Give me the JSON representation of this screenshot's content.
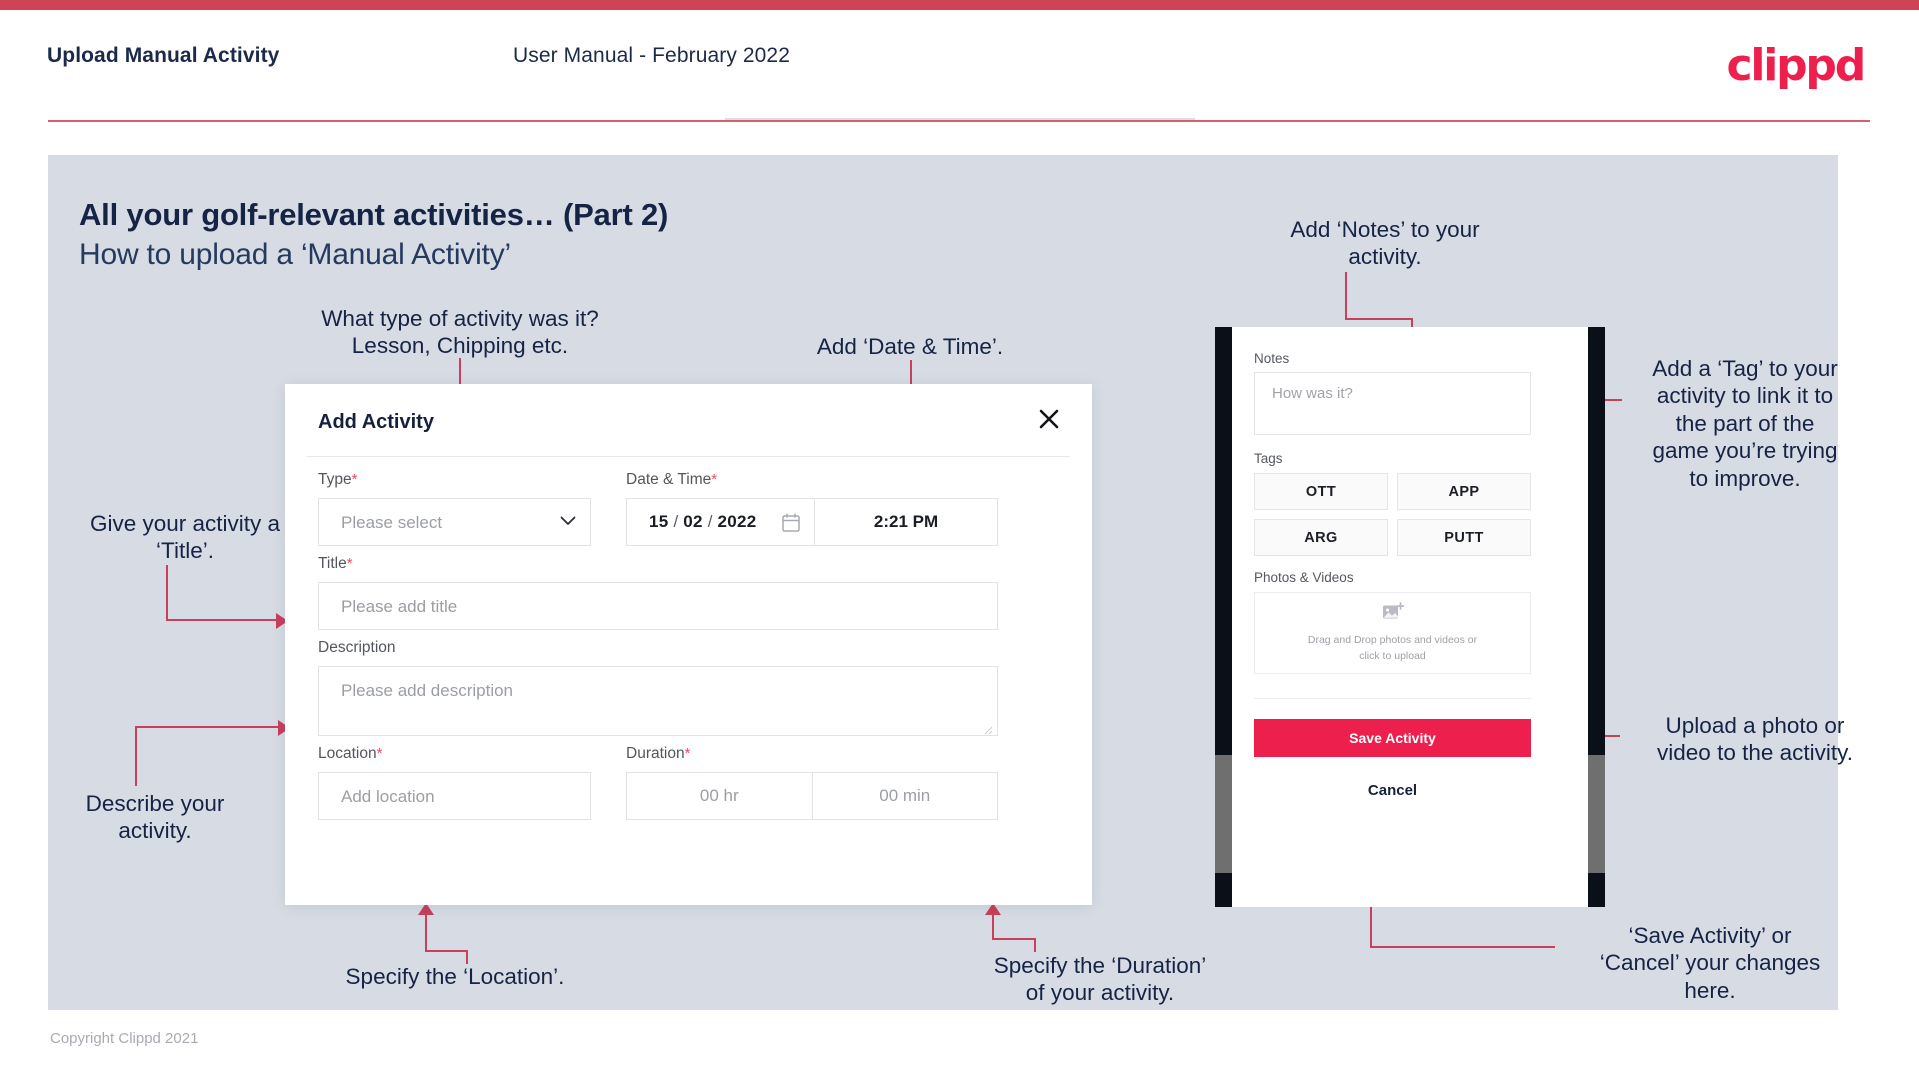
{
  "header": {
    "title": "Upload Manual Activity",
    "subtitle": "User Manual - February 2022",
    "logo": "clippd"
  },
  "slide": {
    "title": "All your golf-relevant activities… (Part 2)",
    "subtitle": "How to upload a ‘Manual Activity’"
  },
  "annotations": {
    "type": "What type of activity was it?\nLesson, Chipping etc.",
    "type_l1": "What type of activity was it?",
    "type_l2": "Lesson, Chipping etc.",
    "datetime": "Add ‘Date & Time’.",
    "title_l1": "Give your activity a",
    "title_l2": "‘Title’.",
    "description_l1": "Describe your",
    "description_l2": "activity.",
    "location": "Specify the ‘Location’.",
    "duration_l1": "Specify the ‘Duration’",
    "duration_l2": "of your activity.",
    "notes_l1": "Add ‘Notes’ to your",
    "notes_l2": "activity.",
    "tags_l1": "Add a ‘Tag’ to your",
    "tags_l2": "activity to link it to",
    "tags_l3": "the part of the",
    "tags_l4": "game you’re trying",
    "tags_l5": "to improve.",
    "upload_l1": "Upload a photo or",
    "upload_l2": "video to the activity.",
    "save_l1": "‘Save Activity’ or",
    "save_l2": "‘Cancel’ your changes",
    "save_l3": "here."
  },
  "modal": {
    "title": "Add Activity",
    "close_icon": "close-icon",
    "fields": {
      "type": {
        "label": "Type",
        "required": "*",
        "placeholder": "Please select",
        "value": ""
      },
      "datetime": {
        "label": "Date & Time",
        "required": "*",
        "day": "15",
        "month": "02",
        "year": "2022",
        "sep": "/",
        "time": "2:21 PM",
        "calendar_icon": "calendar-icon"
      },
      "title": {
        "label": "Title",
        "required": "*",
        "placeholder": "Please add title",
        "value": ""
      },
      "description": {
        "label": "Description",
        "required": "",
        "placeholder": "Please add description",
        "value": ""
      },
      "location": {
        "label": "Location",
        "required": "*",
        "placeholder": "Add location",
        "value": ""
      },
      "duration": {
        "label": "Duration",
        "required": "*",
        "hours_placeholder": "00 hr",
        "minutes_placeholder": "00 min"
      }
    }
  },
  "phone": {
    "notes": {
      "label": "Notes",
      "placeholder": "How was it?"
    },
    "tags": {
      "label": "Tags",
      "items": [
        "OTT",
        "APP",
        "ARG",
        "PUTT"
      ]
    },
    "photos": {
      "label": "Photos & Videos",
      "icon": "add-image-icon",
      "drop_l1": "Drag and Drop photos and videos or",
      "drop_l2": "click to upload"
    },
    "save_label": "Save Activity",
    "cancel_label": "Cancel"
  },
  "footer": {
    "copyright": "Copyright Clippd 2021"
  },
  "colors": {
    "brand": "#ec1f4d",
    "accent_line": "#c8405c",
    "slide_bg": "#d7dce4",
    "text_dark": "#152445"
  }
}
